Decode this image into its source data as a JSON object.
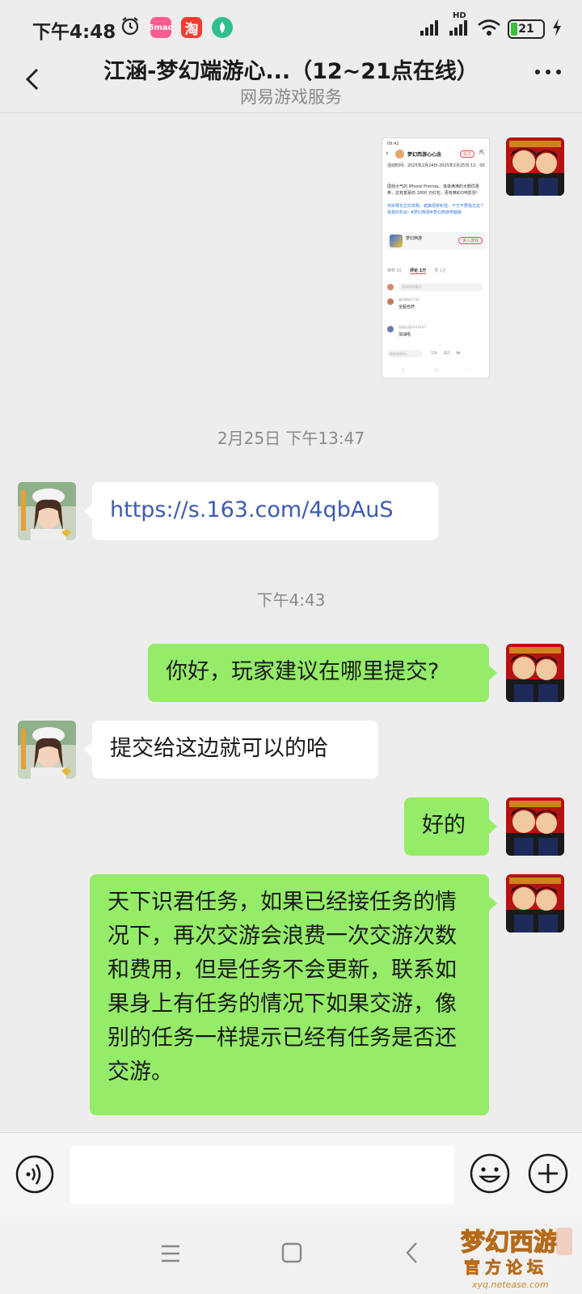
{
  "status_bar": {
    "time": "下午4:48",
    "app_icons": [
      {
        "name": "alarm-icon"
      },
      {
        "name": "app-icon-pink",
        "label": "5mao",
        "color": "#fb5c8f"
      },
      {
        "name": "taobao-icon",
        "label": "淘",
        "color": "#f53c2f"
      },
      {
        "name": "app-icon-green",
        "color": "#2fbf8f"
      }
    ],
    "network": "HD",
    "battery": "21"
  },
  "nav": {
    "title": "江涵-梦幻端游心...（12~21点在线）",
    "subtitle": "网易游戏服务"
  },
  "messages": [
    {
      "id": "m1",
      "from": "me",
      "type": "image"
    },
    {
      "id": "t1",
      "type": "time",
      "text": "2月25日 下午13:47"
    },
    {
      "id": "m2",
      "from": "agent",
      "type": "text",
      "text": "https://s.163.com/4qbAuS"
    },
    {
      "id": "t2",
      "type": "time",
      "text": "下午4:43"
    },
    {
      "id": "m3",
      "from": "me",
      "type": "text",
      "text": "你好，玩家建议在哪里提交?"
    },
    {
      "id": "m4",
      "from": "agent",
      "type": "text",
      "text": "提交给这边就可以的哈"
    },
    {
      "id": "m5",
      "from": "me",
      "type": "text",
      "text": "好的"
    },
    {
      "id": "m6",
      "from": "me",
      "type": "text",
      "text": "天下识君任务，如果已经接任务的情况下，再次交游会浪费一次交游次数和费用，但是任务不会更新，联系如果身上有任务的情况下如果交游，像别的任务一样提示已经有任务是否还交游。"
    }
  ],
  "shot": {
    "page_title": "梦幻西游心心念",
    "badge": "关注",
    "activity_time": "活动时间：2025年2月24日-2025年2月25日 12：00",
    "body": "围观大气的 iPhone Promax，滚滚满满的大额优惠券，这有富豪的 1800 元红包，更有精彩Q电影票!",
    "body2": "赤岸赛花正的攻略，越策把累积强，干万不要错过这个极极的机会! #梦幻西游#梦幻西游电脑版",
    "game_name": "梦幻西游",
    "game_button": "进入游戏",
    "tabs": [
      "推荐 65",
      "评论 1万",
      "赞 1万"
    ],
    "comment_placeholder": "说说你的看法",
    "comments": [
      {
        "user": "放风筝的7741",
        "text": "全服自然"
      },
      {
        "user": "风雨玩家3244407",
        "text": "加油啦"
      }
    ],
    "footer_input": "快来说两句...",
    "footer_counts": [
      "179",
      "327",
      "99"
    ]
  },
  "colors": {
    "bubble_out": "#95ec69",
    "bubble_in": "#ffffff",
    "background": "#ededed"
  },
  "watermark": {
    "title": "梦幻西游",
    "subtitle": "官方论坛",
    "url": "xyq.netease.com"
  }
}
